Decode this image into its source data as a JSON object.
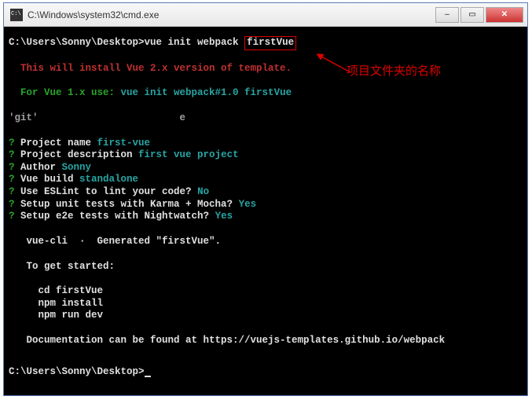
{
  "window": {
    "title": "C:\\Windows\\system32\\cmd.exe"
  },
  "prompt1": {
    "path": "C:\\Users\\Sonny\\Desktop>",
    "cmd": "vue init webpack ",
    "boxed": "firstVue"
  },
  "annotation": {
    "text": "项目文件夹的名称"
  },
  "line_install": "  This will install Vue 2.x version of template.",
  "line_for_prefix": "  For Vue 1.x use: ",
  "line_for_cmd": "vue init webpack#1.0 firstVue",
  "line_git": "'git'                        е",
  "questions": {
    "q1_label": " Project name ",
    "q1_val": "first-vue",
    "q2_label": " Project description ",
    "q2_val": "first vue project",
    "q3_label": " Author ",
    "q3_val": "Sonny",
    "q4_label": " Vue build ",
    "q4_val": "standalone",
    "q5_label": " Use ESLint to lint your code? ",
    "q5_val": "No",
    "q6_label": " Setup unit tests with Karma + Mocha? ",
    "q6_val": "Yes",
    "q7_label": " Setup e2e tests with Nightwatch? ",
    "q7_val": "Yes"
  },
  "output": {
    "generated": "   vue-cli  ·  Generated \"firstVue\".",
    "getstarted": "   To get started:",
    "cd": "     cd firstVue",
    "npm_install": "     npm install",
    "npm_run": "     npm run dev",
    "docs": "   Documentation can be found at https://vuejs-templates.github.io/webpack"
  },
  "prompt2": "C:\\Users\\Sonny\\Desktop>",
  "qmark": "?"
}
